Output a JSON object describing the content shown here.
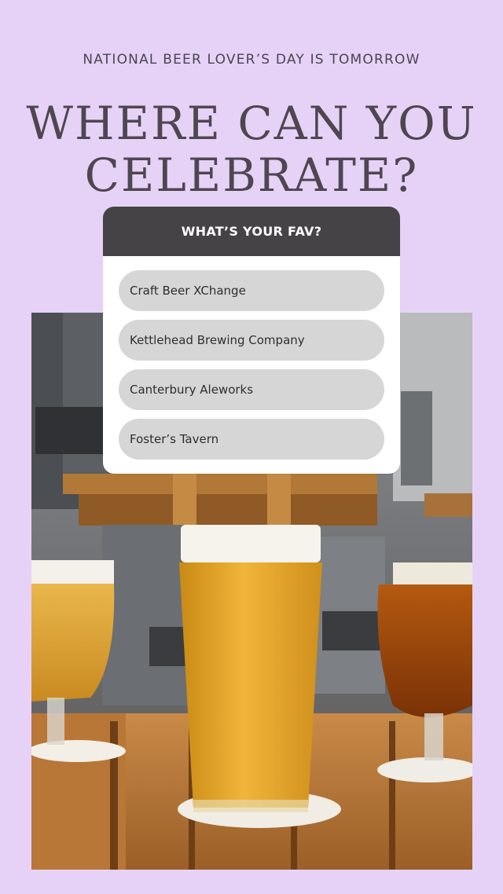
{
  "header": {
    "eyebrow": "NATIONAL BEER LOVER’S DAY IS TOMORROW",
    "headline_line1": "WHERE CAN YOU",
    "headline_line2": "CELEBRATE?"
  },
  "poll": {
    "question": "WHAT’S YOUR FAV?",
    "options": [
      {
        "label": "Craft Beer XChange"
      },
      {
        "label": "Kettlehead Brewing Company"
      },
      {
        "label": "Canterbury Aleworks"
      },
      {
        "label": "Foster’s Tavern"
      }
    ]
  },
  "colors": {
    "background": "#e6d2f7",
    "poll_header": "#454346",
    "option_fill": "#d6d6d6",
    "headline_text": "#4f4650"
  }
}
